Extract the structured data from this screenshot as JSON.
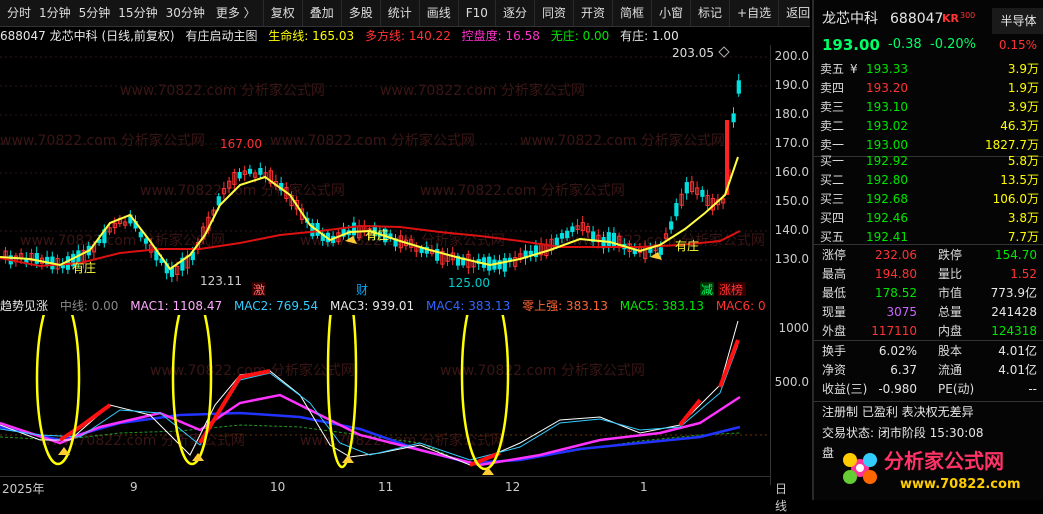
{
  "toolbar": {
    "items": [
      "分时",
      "1分钟",
      "5分钟",
      "15分钟",
      "30分钟",
      "更多 〉",
      "复权",
      "叠加",
      "多股",
      "统计",
      "画线",
      "F10",
      "逐分",
      "同资",
      "开资",
      "简框",
      "小窗",
      "标记",
      "+自选",
      "返回"
    ]
  },
  "info_bar": {
    "code_name": "688047 龙芯中科 (日线,前复权)",
    "indicator": "有庄启动主图",
    "lifeline": "生命线: 165.03",
    "multi_line": "多方线: 140.22",
    "control": "控盘度: 16.58",
    "no_dealer": "无庄: 0.00",
    "has_dealer": "有庄: 1.00"
  },
  "main_chart": {
    "price_axis": [
      "200.0",
      "190.0",
      "180.0",
      "170.0",
      "160.0",
      "150.0",
      "140.0",
      "130.0"
    ],
    "annotations": {
      "high_label": "167.00",
      "low_label_1": "123.11",
      "low_label_2": "125.00",
      "peak_label": "203.05",
      "signal_1": "有庄",
      "signal_2": "有庄",
      "signal_3": "有庄",
      "tag_ji": "激",
      "tag_cai": "财",
      "tag_jian": "减",
      "tag_zhang": "涨榜"
    },
    "watermark": "www.70822.com 分析家公式网"
  },
  "indicator_bar": {
    "name": "趋势见涨",
    "zero_line": "中线: 0.00",
    "mac1": "MAC1: 1108.47",
    "mac2": "MAC2: 769.54",
    "mac3": "MAC3: 939.01",
    "mac4": "MAC4: 383.13",
    "up": "零上强: 383.13",
    "mac5": "MAC5: 383.13",
    "mac6": "MAC6: 0"
  },
  "indicator_axis": [
    "1000",
    "500.0"
  ],
  "date_axis": [
    "2025年",
    "9",
    "10",
    "11",
    "12",
    "1"
  ],
  "period": "日线",
  "quote": {
    "name": "龙芯中科",
    "code": "688047",
    "badge": "KR",
    "badge_sub": "300",
    "tab": "半导体",
    "price": "193.00",
    "change": "-0.38",
    "change_pct": "-0.20%",
    "tab_pct": "0.15%"
  },
  "order_book": {
    "asks": [
      {
        "label": "卖五",
        "sym": "¥",
        "price": "193.33",
        "vol": "3.9万"
      },
      {
        "label": "卖四",
        "sym": "",
        "price": "193.20",
        "vol": "1.9万"
      },
      {
        "label": "卖三",
        "sym": "",
        "price": "193.10",
        "vol": "3.9万"
      },
      {
        "label": "卖二",
        "sym": "",
        "price": "193.02",
        "vol": "46.3万"
      },
      {
        "label": "卖一",
        "sym": "",
        "price": "193.00",
        "vol": "1827.7万"
      }
    ],
    "bids": [
      {
        "label": "买一",
        "price": "192.92",
        "vol": "5.8万"
      },
      {
        "label": "买二",
        "price": "192.80",
        "vol": "13.5万"
      },
      {
        "label": "买三",
        "price": "192.68",
        "vol": "106.0万"
      },
      {
        "label": "买四",
        "price": "192.46",
        "vol": "3.8万"
      },
      {
        "label": "买五",
        "price": "192.41",
        "vol": "7.7万"
      }
    ]
  },
  "stats": [
    {
      "l1": "涨停",
      "v1": "232.06",
      "c1": "#ff3333",
      "l2": "跌停",
      "v2": "154.70",
      "c2": "#00e600"
    },
    {
      "l1": "最高",
      "v1": "194.80",
      "c1": "#ff3333",
      "l2": "量比",
      "v2": "1.52",
      "c2": "#ff3333"
    },
    {
      "l1": "最低",
      "v1": "178.52",
      "c1": "#00e600",
      "l2": "市值",
      "v2": "773.9亿",
      "c2": "#e6e6e6"
    },
    {
      "l1": "现量",
      "v1": "3075",
      "c1": "#cc66ff",
      "l2": "总量",
      "v2": "241428",
      "c2": "#e6e6e6"
    },
    {
      "l1": "外盘",
      "v1": "117110",
      "c1": "#ff3333",
      "l2": "内盘",
      "v2": "124318",
      "c2": "#00e600"
    }
  ],
  "stats2": [
    {
      "l1": "换手",
      "v1": "6.02%",
      "l2": "股本",
      "v2": "4.01亿"
    },
    {
      "l1": "净资",
      "v1": "6.37",
      "l2": "流通",
      "v2": "4.01亿"
    },
    {
      "l1": "收益(三)",
      "v1": "-0.980",
      "l2": "PE(动)",
      "v2": "--"
    }
  ],
  "footer": {
    "reg": "注册制 已盈利 表决权无差异",
    "status": "交易状态: 闭市阶段 15:30:08",
    "pan": "盘"
  },
  "logo": {
    "title": "分析家公式网",
    "url": "www.70822.com"
  },
  "colors": {
    "up": "#ff3333",
    "down": "#00e600",
    "lifeline": "#ffff00",
    "multiline": "#dd1111",
    "accent": "#00ffff"
  }
}
